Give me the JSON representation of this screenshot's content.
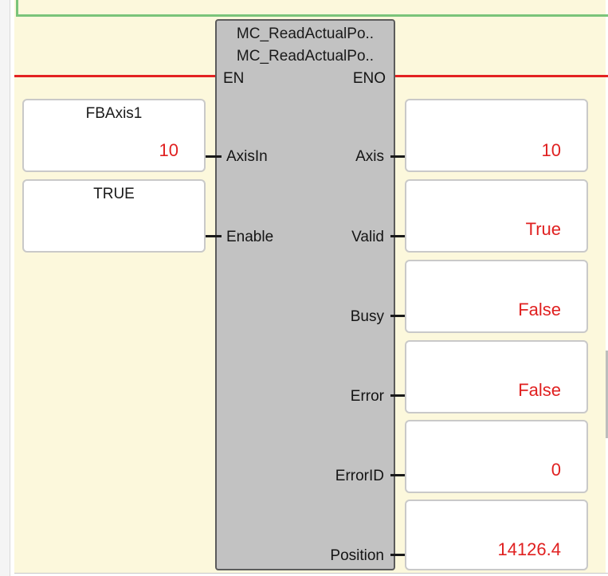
{
  "function_block": {
    "instance_name": "MC_ReadActualPo..",
    "type_name": "MC_ReadActualPo..",
    "inputs": [
      {
        "name": "EN"
      },
      {
        "name": "AxisIn"
      },
      {
        "name": "Enable"
      }
    ],
    "outputs": [
      {
        "name": "ENO"
      },
      {
        "name": "Axis"
      },
      {
        "name": "Valid"
      },
      {
        "name": "Busy"
      },
      {
        "name": "Error"
      },
      {
        "name": "ErrorID"
      },
      {
        "name": "Position"
      }
    ]
  },
  "input_variables": [
    {
      "name": "FBAxis1",
      "value": "10"
    },
    {
      "name": "TRUE",
      "value": ""
    }
  ],
  "output_variables": [
    {
      "value": "10"
    },
    {
      "value": "True"
    },
    {
      "value": "False"
    },
    {
      "value": "False"
    },
    {
      "value": "0"
    },
    {
      "value": "14126.4"
    }
  ],
  "colors": {
    "power_flow": "#e32222",
    "rung_background": "#fcf8dc",
    "block_fill": "#c2c2c2",
    "live_value": "#e02020"
  }
}
